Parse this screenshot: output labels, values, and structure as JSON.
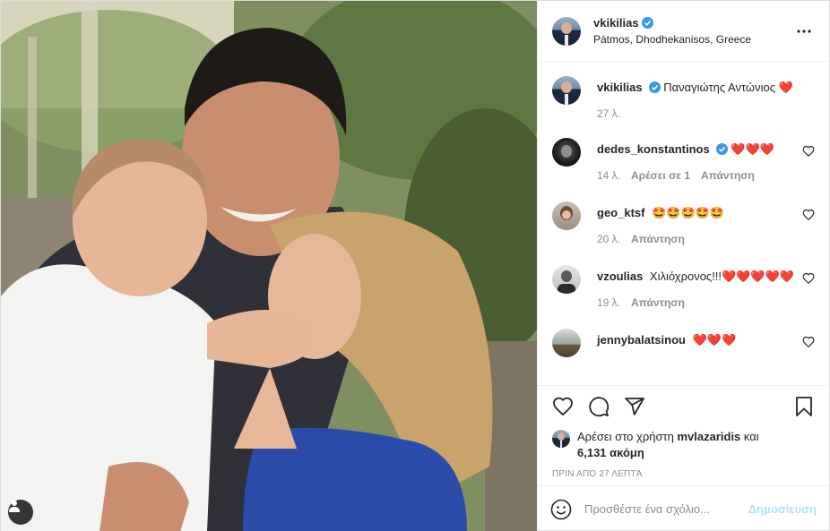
{
  "post": {
    "username": "vkikilias",
    "location": "Pátmos, Dhodhekanisos, Greece",
    "verified": true
  },
  "caption": {
    "username": "vkikilias",
    "text": "Παναγιώτης Αντώνιος ❤️",
    "age": "27 λ."
  },
  "comments": [
    {
      "username": "dedes_konstantinos",
      "verified": true,
      "text": "❤️❤️❤️",
      "age": "14 λ.",
      "likes": "Αρέσει σε 1",
      "reply": "Απάντηση"
    },
    {
      "username": "geo_ktsf",
      "verified": false,
      "text": "🤩🤩🤩🤩🤩",
      "age": "20 λ.",
      "likes": "",
      "reply": "Απάντηση"
    },
    {
      "username": "vzoulias",
      "verified": false,
      "text": "Χιλιόχρονος!!!❤️❤️❤️❤️❤️",
      "age": "19 λ.",
      "likes": "",
      "reply": "Απάντηση"
    },
    {
      "username": "jennybalatsinou",
      "verified": false,
      "text": "❤️❤️❤️",
      "age": "",
      "likes": "",
      "reply": ""
    }
  ],
  "likes": {
    "prefix": "Αρέσει στο χρήστη",
    "user": "mvlazaridis",
    "joiner": "και",
    "count": "6,131 ακόμη"
  },
  "timestamp": "ΠΡΙΝ ΑΠΌ 27 ΛΕΠΤΆ",
  "add_comment": {
    "placeholder": "Προσθέστε ένα σχόλιο...",
    "post_label": "Δημοσίευση"
  },
  "icons": {
    "like": "heart-icon",
    "comment": "comment-icon",
    "share": "share-icon",
    "save": "bookmark-icon",
    "more": "more-icon",
    "emoji": "emoji-icon",
    "tag": "user-tag-icon"
  },
  "colors": {
    "verified": "#3897f0",
    "link": "#b2dffc",
    "secondary_text": "#8e8e8e",
    "border": "#efefef"
  }
}
